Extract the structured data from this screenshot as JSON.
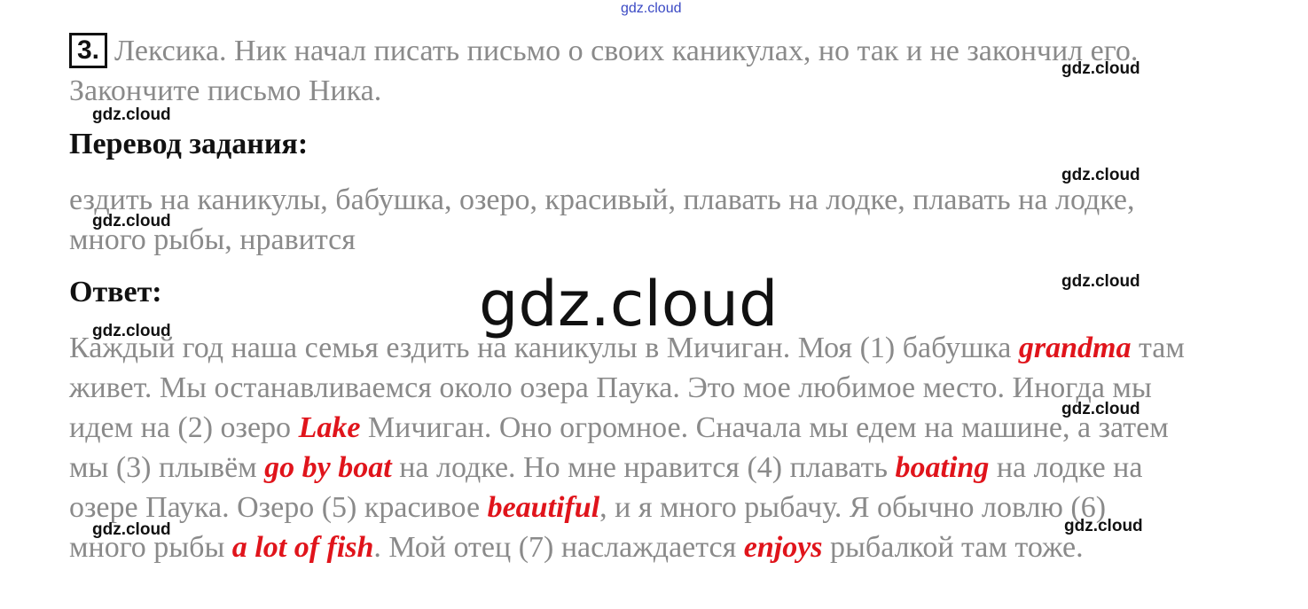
{
  "watermark": {
    "top": "gdz.cloud",
    "small": "gdz.cloud",
    "big": "gdz.cloud"
  },
  "task": {
    "number": "3.",
    "text": "Лексика. Ник начал писать письмо о своих каникулах, но так и не закончил его. Закончите письмо Ника."
  },
  "translation": {
    "heading": "Перевод задания:",
    "text": "ездить на каникулы, бабушка, озеро, красивый, плавать на лодке, плавать на лодке, много рыбы, нравится"
  },
  "answer": {
    "heading": "Ответ:",
    "segments": [
      {
        "t": "Каждый год наша семья ездить на каникулы в Мичиган. Моя (1) бабушка "
      },
      {
        "t": "grandma",
        "a": true
      },
      {
        "t": " там живет. Мы останавливаемся около озера Паука. Это мое любимое место. Иногда мы идем на (2) озеро "
      },
      {
        "t": "Lake",
        "a": true
      },
      {
        "t": " Мичиган. Оно огромное. Сначала мы едем на машине, а затем мы (3) плывём "
      },
      {
        "t": "go by boat",
        "a": true
      },
      {
        "t": " на лодке. Но мне нравится (4) плавать "
      },
      {
        "t": "boating",
        "a": true
      },
      {
        "t": " на лодке на озере Паука. Озеро (5) красивое "
      },
      {
        "t": "beautiful",
        "a": true
      },
      {
        "t": ", и я много рыбачу. Я обычно ловлю (6) много рыбы "
      },
      {
        "t": "a lot of fish",
        "a": true
      },
      {
        "t": ". Мой отец (7) наслаждается "
      },
      {
        "t": "enjoys",
        "a": true
      },
      {
        "t": " рыбалкой там тоже."
      }
    ]
  }
}
